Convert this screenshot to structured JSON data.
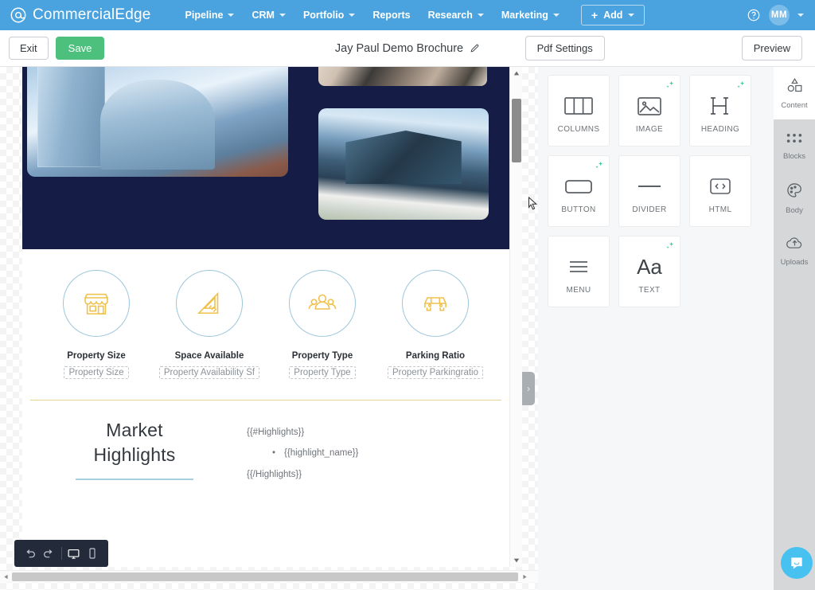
{
  "topnav": {
    "brand": "CommercialEdge",
    "brand_icon": "at-circle-logo-icon",
    "items": [
      {
        "label": "Pipeline",
        "has_caret": true
      },
      {
        "label": "CRM",
        "has_caret": true
      },
      {
        "label": "Portfolio",
        "has_caret": true
      },
      {
        "label": "Reports",
        "has_caret": false
      },
      {
        "label": "Research",
        "has_caret": true
      },
      {
        "label": "Marketing",
        "has_caret": true
      }
    ],
    "add_button": "Add",
    "help_icon": "question-circle-icon",
    "avatar_initials": "MM",
    "accent_color": "#4aa3df"
  },
  "toolbar": {
    "exit_label": "Exit",
    "save_label": "Save",
    "save_color": "#4dc07d",
    "doc_title": "Jay Paul Demo Brochure",
    "edit_icon": "pencil-icon",
    "pdf_settings_label": "Pdf Settings",
    "preview_label": "Preview"
  },
  "canvas": {
    "features": [
      {
        "title": "Property Size",
        "token": "Property Size",
        "icon": "storefront-icon"
      },
      {
        "title": "Space Available",
        "token": "Property Availability Sf",
        "icon": "set-square-ruler-icon"
      },
      {
        "title": "Property Type",
        "token": "Property Type",
        "icon": "people-group-icon"
      },
      {
        "title": "Parking Ratio",
        "token": "Property Parkingratio",
        "icon": "car-icon"
      }
    ],
    "highlights": {
      "title_line1": "Market",
      "title_line2": "Highlights",
      "open_tag": "{{#Highlights}}",
      "bullet": "{{highlight_name}}",
      "close_tag": "{{/Highlights}}"
    },
    "device_toolbar": {
      "undo_icon": "undo-arrow-icon",
      "redo_icon": "redo-arrow-icon",
      "desktop_icon": "desktop-monitor-icon",
      "mobile_icon": "mobile-phone-icon"
    },
    "collapse_handle_icon": "chevron-right-icon"
  },
  "blocks_panel": {
    "blocks": [
      {
        "label": "COLUMNS",
        "icon": "columns-icon",
        "ai_badge": false
      },
      {
        "label": "IMAGE",
        "icon": "image-icon",
        "ai_badge": true
      },
      {
        "label": "HEADING",
        "icon": "heading-h-icon",
        "ai_badge": true
      },
      {
        "label": "BUTTON",
        "icon": "button-icon",
        "ai_badge": true
      },
      {
        "label": "DIVIDER",
        "icon": "divider-icon",
        "ai_badge": false
      },
      {
        "label": "HTML",
        "icon": "code-html-icon",
        "ai_badge": false
      },
      {
        "label": "MENU",
        "icon": "menu-lines-icon",
        "ai_badge": false
      },
      {
        "label": "TEXT",
        "icon": "text-aa-icon",
        "ai_badge": true
      }
    ],
    "ai_badge_color": "#3ec9a0"
  },
  "rail": {
    "items": [
      {
        "label": "Content",
        "icon": "shapes-icon",
        "active": true
      },
      {
        "label": "Blocks",
        "icon": "grid-dots-icon",
        "active": false
      },
      {
        "label": "Body",
        "icon": "palette-icon",
        "active": false
      },
      {
        "label": "Uploads",
        "icon": "cloud-upload-icon",
        "active": false
      }
    ],
    "chat_icon": "chat-bubble-icon",
    "chat_color": "#47c1f0"
  }
}
